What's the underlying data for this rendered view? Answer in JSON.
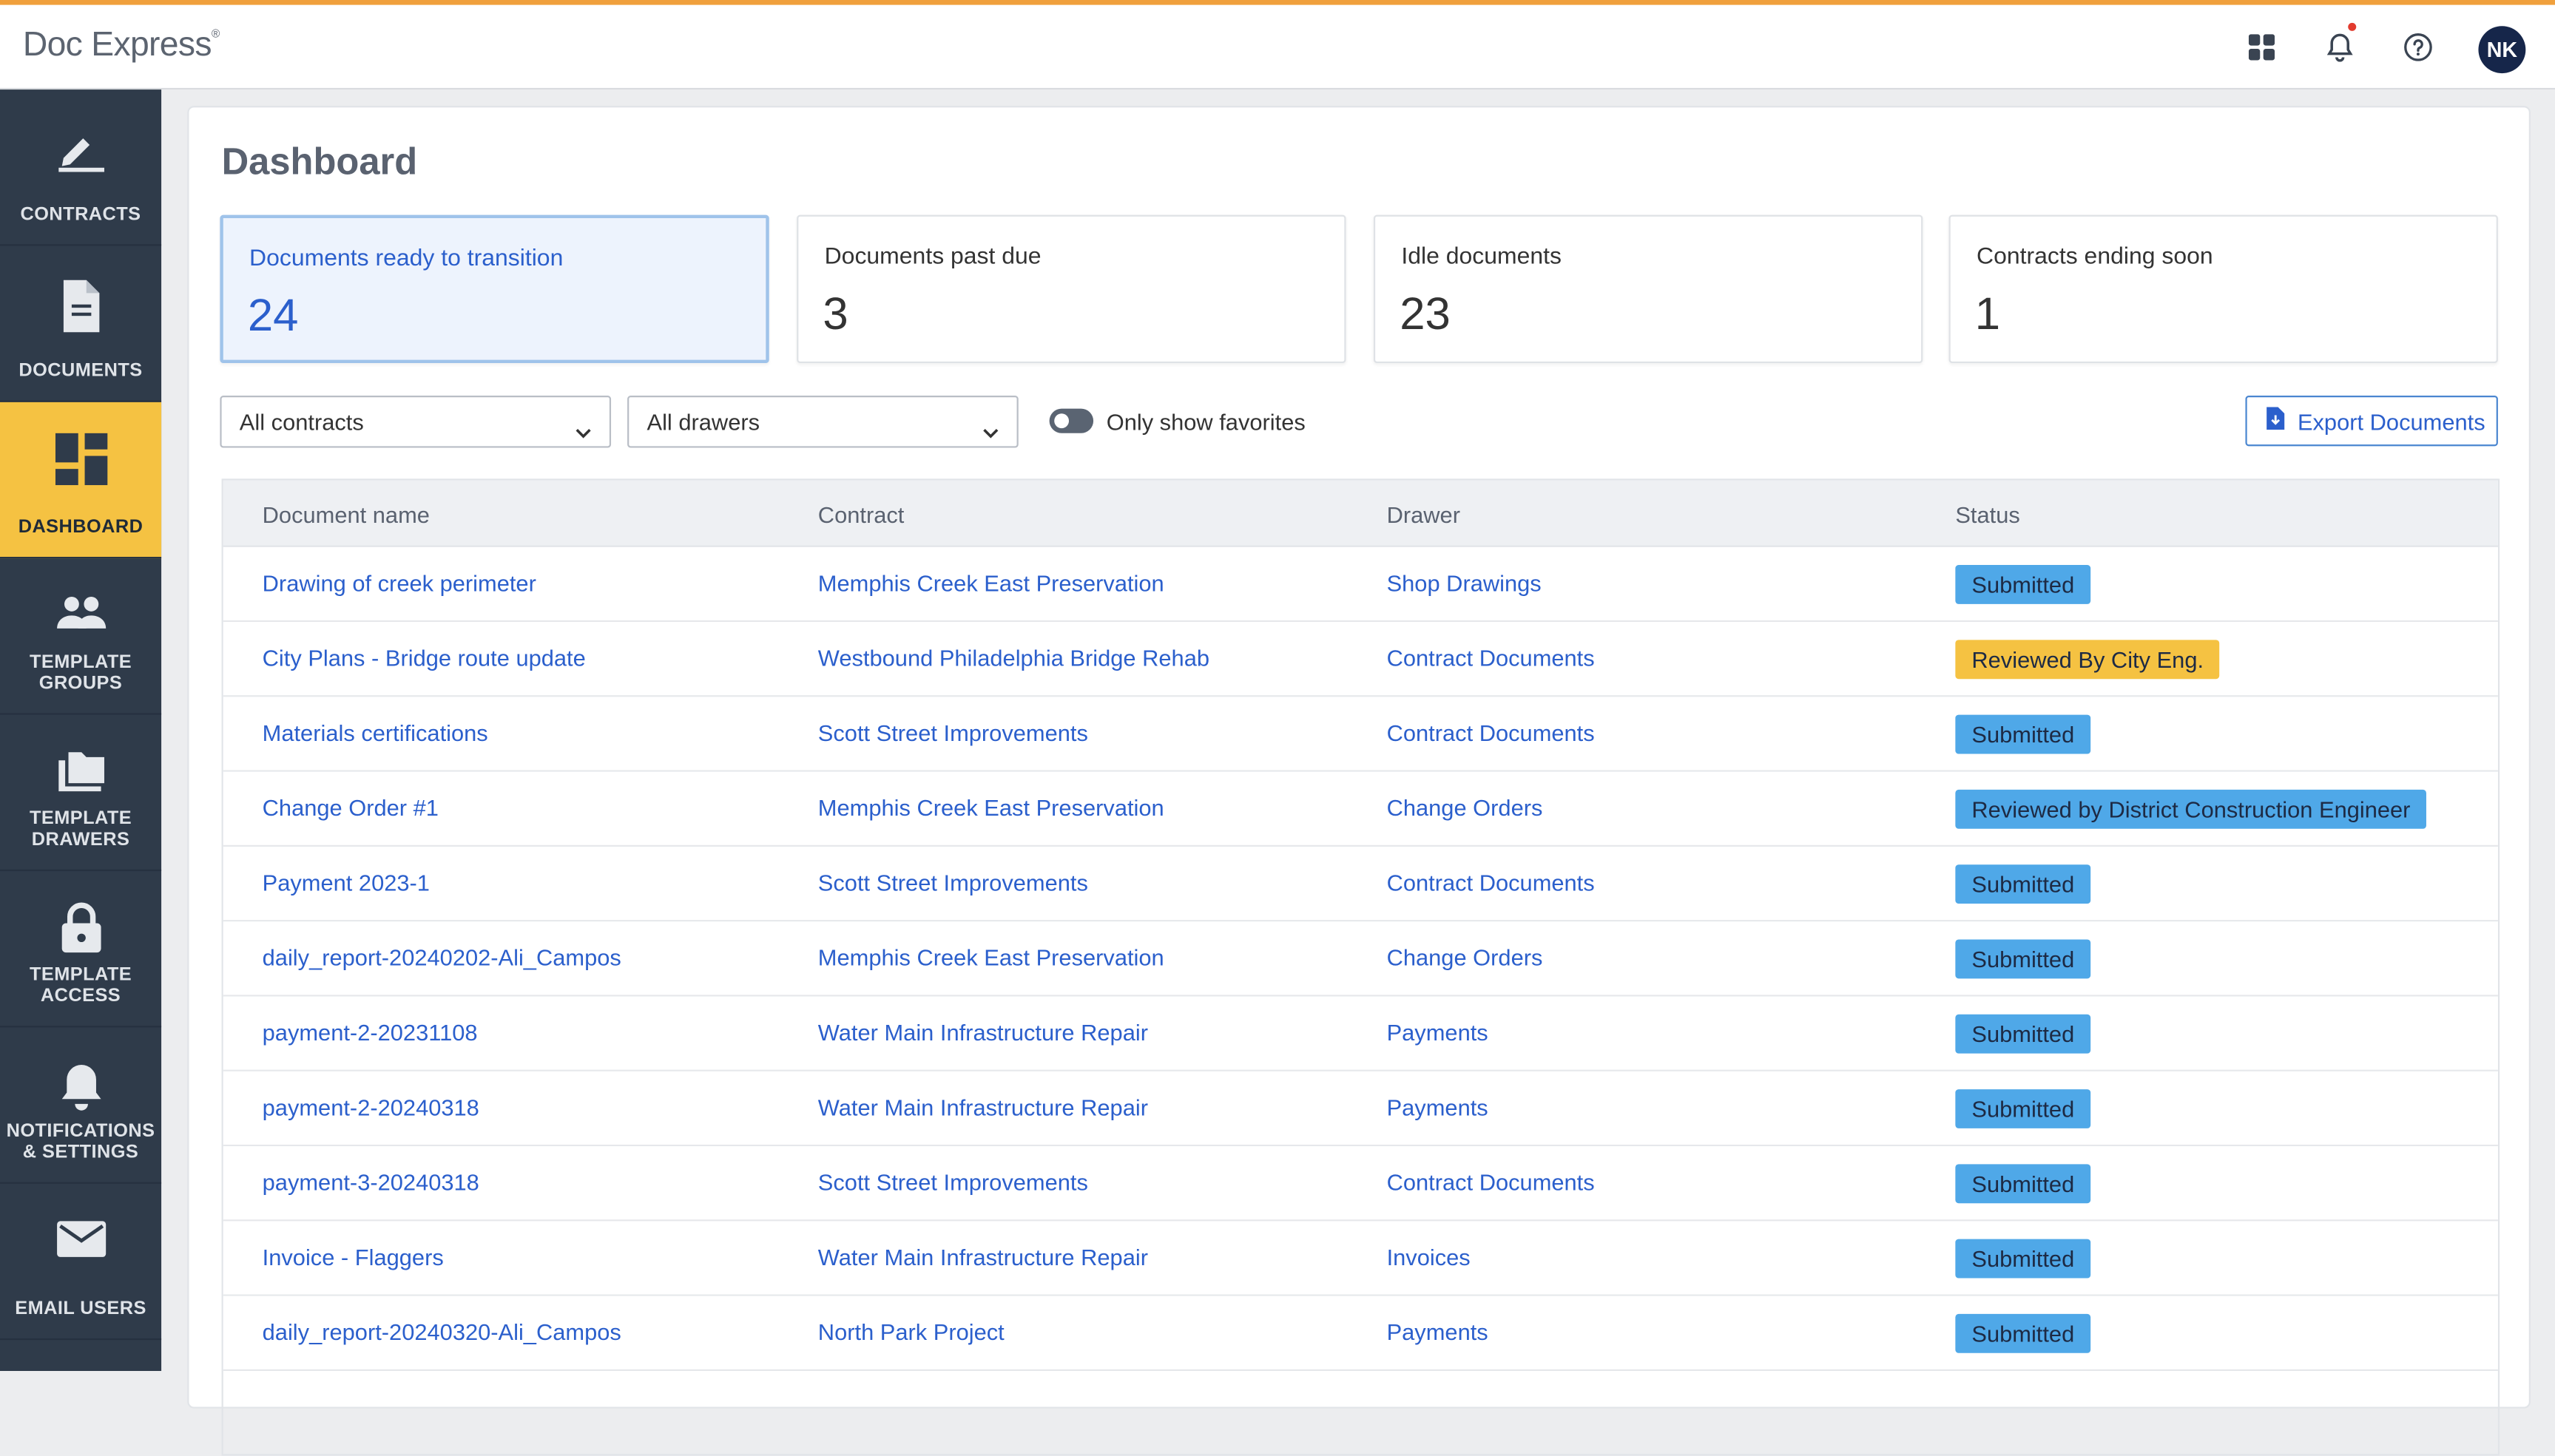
{
  "app": {
    "brand": "Doc Express",
    "brand_mark": "®",
    "user_initials": "NK"
  },
  "colors": {
    "accent": "#f0a03c",
    "sidebar": "#2f3b4a",
    "active_nav": "#f5c242",
    "link": "#2b5fcc",
    "badge_blue": "#4fa8e8",
    "badge_yellow": "#f5c242"
  },
  "sidebar": {
    "items": [
      {
        "label": "CONTRACTS",
        "icon": "pen-icon",
        "active": false
      },
      {
        "label": "DOCUMENTS",
        "icon": "document-icon",
        "active": false
      },
      {
        "label": "DASHBOARD",
        "icon": "dashboard-icon",
        "active": true
      },
      {
        "label": "TEMPLATE\nGROUPS",
        "icon": "people-icon",
        "active": false
      },
      {
        "label": "TEMPLATE\nDRAWERS",
        "icon": "folder-icon",
        "active": false
      },
      {
        "label": "TEMPLATE\nACCESS",
        "icon": "lock-icon",
        "active": false
      },
      {
        "label": "NOTIFICATIONS\n& SETTINGS",
        "icon": "bell-icon",
        "active": false
      },
      {
        "label": "EMAIL USERS",
        "icon": "mail-icon",
        "active": false
      }
    ]
  },
  "dashboard": {
    "title": "Dashboard",
    "cards": [
      {
        "label": "Documents ready to transition",
        "value": "24"
      },
      {
        "label": "Documents past due",
        "value": "3"
      },
      {
        "label": "Idle documents",
        "value": "23"
      },
      {
        "label": "Contracts ending soon",
        "value": "1"
      }
    ],
    "filters": {
      "contracts_selected": "All contracts",
      "drawers_selected": "All drawers",
      "favorites_label": "Only show favorites"
    },
    "export_label": "Export Documents"
  },
  "table": {
    "headers": [
      "Document name",
      "Contract",
      "Drawer",
      "Status"
    ],
    "rows": [
      {
        "name": "Drawing of creek perimeter",
        "contract": "Memphis Creek East Preservation",
        "drawer": "Shop Drawings",
        "status": "Submitted",
        "status_color": "blue"
      },
      {
        "name": "City Plans - Bridge route update",
        "contract": "Westbound Philadelphia Bridge Rehab",
        "drawer": "Contract Documents",
        "status": "Reviewed By City Eng.",
        "status_color": "yellow"
      },
      {
        "name": "Materials certifications",
        "contract": "Scott Street Improvements",
        "drawer": "Contract Documents",
        "status": "Submitted",
        "status_color": "blue"
      },
      {
        "name": "Change Order #1",
        "contract": "Memphis Creek East Preservation",
        "drawer": "Change Orders",
        "status": "Reviewed by District Construction Engineer",
        "status_color": "blue"
      },
      {
        "name": "Payment 2023-1",
        "contract": "Scott Street Improvements",
        "drawer": "Contract Documents",
        "status": "Submitted",
        "status_color": "blue"
      },
      {
        "name": "daily_report-20240202-Ali_Campos",
        "contract": "Memphis Creek East Preservation",
        "drawer": "Change Orders",
        "status": "Submitted",
        "status_color": "blue"
      },
      {
        "name": "payment-2-20231108",
        "contract": "Water Main Infrastructure Repair",
        "drawer": "Payments",
        "status": "Submitted",
        "status_color": "blue"
      },
      {
        "name": "payment-2-20240318",
        "contract": "Water Main Infrastructure Repair",
        "drawer": "Payments",
        "status": "Submitted",
        "status_color": "blue"
      },
      {
        "name": "payment-3-20240318",
        "contract": "Scott Street Improvements",
        "drawer": "Contract Documents",
        "status": "Submitted",
        "status_color": "blue"
      },
      {
        "name": "Invoice - Flaggers",
        "contract": "Water Main Infrastructure Repair",
        "drawer": "Invoices",
        "status": "Submitted",
        "status_color": "blue"
      },
      {
        "name": "daily_report-20240320-Ali_Campos",
        "contract": "North Park Project",
        "drawer": "Payments",
        "status": "Submitted",
        "status_color": "blue"
      }
    ]
  }
}
